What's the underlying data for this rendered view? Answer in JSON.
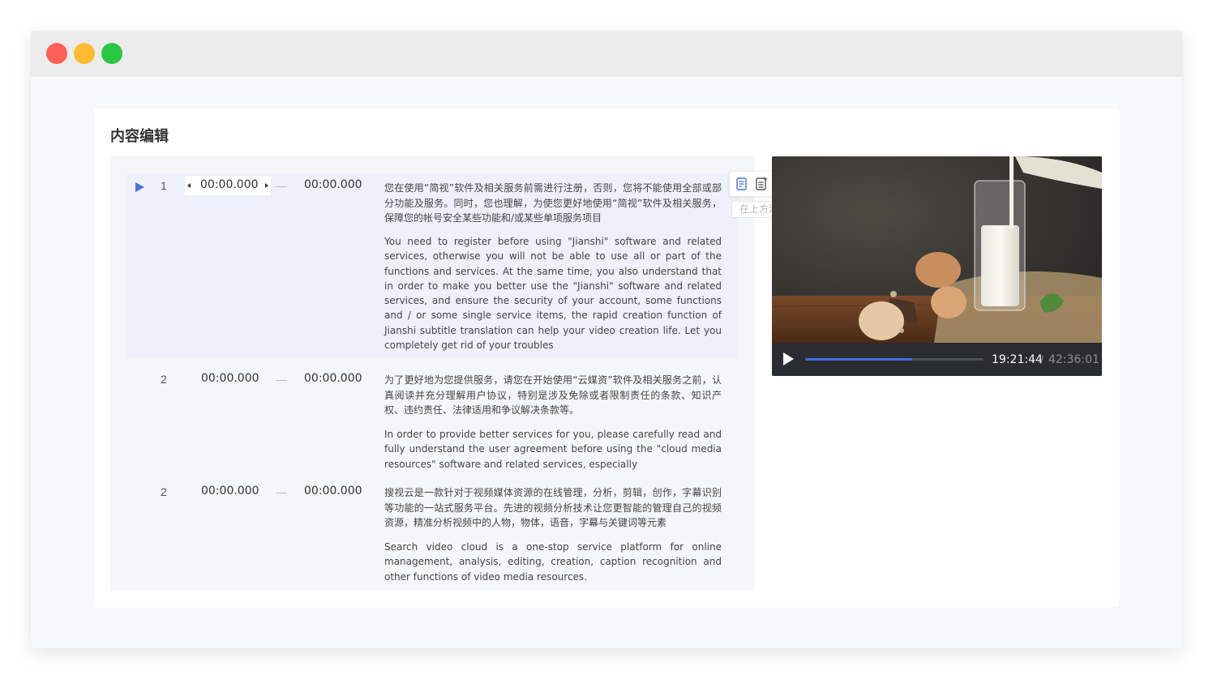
{
  "window": {
    "title_dots": [
      "close",
      "minimize",
      "maximize"
    ]
  },
  "page": {
    "title": "内容编辑"
  },
  "rows": [
    {
      "index": "1",
      "start": "00:00.000",
      "end": "00:00.000",
      "cn": "您在使用“简视”软件及相关服务前需进行注册，否则，您将不能使用全部或部分功能及服务。同时，您也理解，为使您更好地使用“简视”软件及相关服务，保障您的帐号安全某些功能和/或某些单项服务项目",
      "en": "You need to register before using \"Jianshi\" software and related services, otherwise you will not be able to use all or part of the functions and services. At the same time, you also understand that in order to make you better use the \"Jianshi\" software and related services, and ensure the security of your account, some functions and / or some single service items, the rapid creation function of Jianshi subtitle translation can help your video creation life. Let you completely get rid of your troubles"
    },
    {
      "index": "2",
      "start": "00:00.000",
      "end": "00:00.000",
      "cn": "为了更好地为您提供服务，请您在开始使用“云媒资”软件及相关服务之前，认真阅读并充分理解用户协议，特别是涉及免除或者限制责任的条款、知识产权、违约责任、法律适用和争议解决条款等。",
      "en": "In order to provide better services for you, please carefully read and fully understand the user agreement before using the \"cloud media resources\" software and related services, especially"
    },
    {
      "index": "2",
      "start": "00:00.000",
      "end": "00:00.000",
      "cn": "搜视云是一款针对于视频媒体资源的在线管理，分析，剪辑，创作，字幕识别等功能的一站式服务平台。先进的视频分析技术让您更智能的管理自己的视频资源，精准分析视频中的人物，物体，语音，字幕与关键词等元素",
      "en": "Search video cloud is a one-stop service platform for online management, analysis, editing, creation, caption recognition and other functions of video media resources."
    }
  ],
  "separator": "—",
  "toolbar": {
    "icons": [
      "add-above-icon",
      "add-below-icon",
      "translate-icon",
      "delete-icon"
    ],
    "tooltip": "在上方添加字幕"
  },
  "player": {
    "current_time": "19:21:44",
    "separator": "/",
    "total_time": "42:36:01",
    "progress": 0.6
  },
  "colors": {
    "accent": "#4c6fe0",
    "delete": "#f06a6a",
    "active_row": "#eef1fb"
  }
}
